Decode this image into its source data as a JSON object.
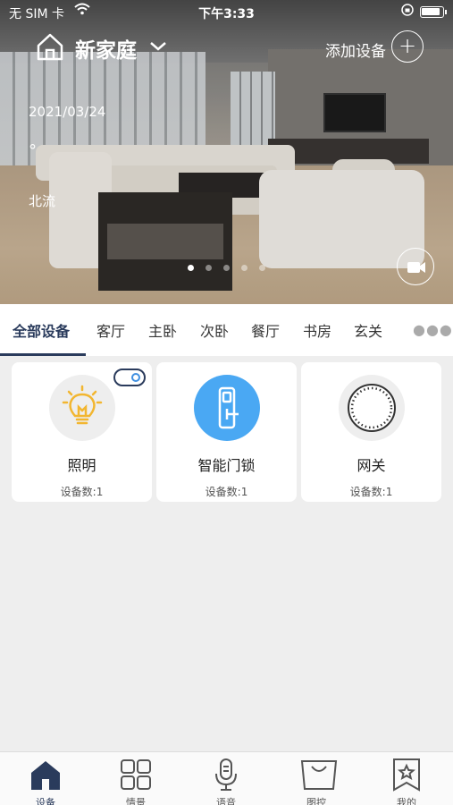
{
  "status_bar": {
    "carrier": "无 SIM 卡",
    "time": "下午3:33",
    "battery_level": 0.9
  },
  "header": {
    "home_name": "新家庭",
    "add_device_label": "添加设备",
    "add_icon": "plus-icon"
  },
  "weather": {
    "date": "2021/03/24",
    "temperature": "°",
    "wind": "北流"
  },
  "carousel": {
    "slides": 5,
    "active_index": 0
  },
  "tabs": [
    {
      "label": "全部设备",
      "active": true
    },
    {
      "label": "客厅"
    },
    {
      "label": "主卧"
    },
    {
      "label": "次卧"
    },
    {
      "label": "餐厅"
    },
    {
      "label": "书房"
    },
    {
      "label": "玄关"
    }
  ],
  "more_icon": "more-dots-icon",
  "cards": [
    {
      "name": "照明",
      "count": "设备数:1",
      "icon": "lightbulb-icon",
      "icon_bg": "#eeeeee",
      "toggle_on": true
    },
    {
      "name": "智能门锁",
      "count": "设备数:1",
      "icon": "door-lock-icon",
      "icon_bg": "#4aa8f3"
    },
    {
      "name": "网关",
      "count": "设备数:1",
      "icon": "gateway-icon",
      "icon_bg": "#eeeeee"
    }
  ],
  "bottom_nav": [
    {
      "label": "设备",
      "icon": "home-icon",
      "active": true
    },
    {
      "label": "情景",
      "icon": "grid-icon"
    },
    {
      "label": "语音",
      "icon": "microphone-icon"
    },
    {
      "label": "图控",
      "icon": "shopping-bag-icon"
    },
    {
      "label": "我的",
      "icon": "bookmark-star-icon"
    }
  ],
  "colors": {
    "accent": "#2a3b5c",
    "lock_blue": "#4aa8f3",
    "bulb_yellow": "#f2b630",
    "background": "#eeeeee"
  }
}
